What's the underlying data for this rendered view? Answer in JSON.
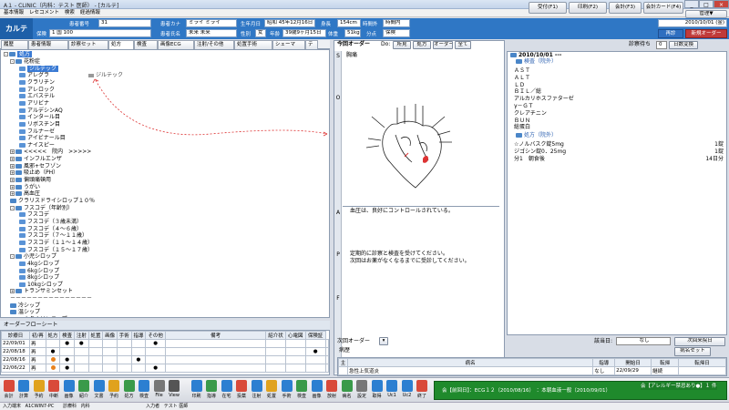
{
  "app": {
    "title": "A１ - CLINIC（内科：テスト 医師） - [カルテ]",
    "menu": [
      "基本情報",
      "レセコメント",
      "検索",
      "経過情報"
    ],
    "top_buttons": [
      "受付(F1)",
      "印刷(F2)",
      "会計(F3)",
      "会計カード(F4)",
      "管理▼"
    ],
    "window_controls": [
      "_",
      "□",
      "×"
    ],
    "status": [
      "入力端末",
      "A1CWIN7-PC",
      "診療科",
      "内科",
      "入力者",
      "テスト 医師"
    ]
  },
  "header": {
    "karte_label": "カルテ",
    "patient_no_label": "患者番号",
    "patient_no": "31",
    "insurance_label": "保険",
    "insurance": "1 国 100",
    "kana_label": "患者カナ",
    "kana": "ミライ ミライ",
    "name_label": "患者氏名",
    "name": "未来 未来",
    "birth_label": "生年月日",
    "birth": "昭和 45年12月16日",
    "sex_label": "性別",
    "sex": "女",
    "age_label": "年齢",
    "age": "39歳9ヶ月15日",
    "height_label": "身長",
    "height": "154cm",
    "weight_label": "体重",
    "weight": "51kg",
    "time_label": "時間外",
    "time_value": "時間内",
    "bunten_label": "分点",
    "bunten_value": "保険",
    "date": "2010/10/01 (金)",
    "btn_resend": "再診",
    "btn_new_order": "新規オーダー"
  },
  "tabs": [
    "履歴",
    "患者情報",
    "診察セット",
    "処方",
    "検査",
    "画像ECG",
    "注射/その他",
    "処置手術",
    "シェーマ",
    "テ"
  ],
  "tree": {
    "root": "処方",
    "drag_hint": "ジルテック",
    "items": [
      {
        "label": "花粉症",
        "level": 1,
        "type": "folder",
        "expand": "-"
      },
      {
        "label": "ジルテック",
        "level": 2,
        "type": "file",
        "selected": true
      },
      {
        "label": "アレグラ",
        "level": 2,
        "type": "file"
      },
      {
        "label": "クラリチン",
        "level": 2,
        "type": "file"
      },
      {
        "label": "アレロック",
        "level": 2,
        "type": "file"
      },
      {
        "label": "エバステル",
        "level": 2,
        "type": "file"
      },
      {
        "label": "アリビナ",
        "level": 2,
        "type": "file"
      },
      {
        "label": "アルデシンAQ",
        "level": 2,
        "type": "file"
      },
      {
        "label": "インタール目",
        "level": 2,
        "type": "file"
      },
      {
        "label": "リボスチン目",
        "level": 2,
        "type": "file"
      },
      {
        "label": "フルナーゼ",
        "level": 2,
        "type": "file"
      },
      {
        "label": "アイビナール目",
        "level": 2,
        "type": "file"
      },
      {
        "label": "ナイスピー",
        "level": 2,
        "type": "file"
      },
      {
        "label": "<<<<<　院内　>>>>>",
        "level": 1,
        "type": "folder",
        "expand": "+"
      },
      {
        "label": "インフルエンザ",
        "level": 1,
        "type": "folder",
        "expand": "+"
      },
      {
        "label": "風邪+セフゾン",
        "level": 1,
        "type": "folder",
        "expand": "+"
      },
      {
        "label": "吸止め（PH）",
        "level": 1,
        "type": "folder",
        "expand": "+"
      },
      {
        "label": "偏頭痛頓用",
        "level": 1,
        "type": "folder",
        "expand": "+"
      },
      {
        "label": "うがい",
        "level": 1,
        "type": "folder",
        "expand": "+"
      },
      {
        "label": "高血圧",
        "level": 1,
        "type": "folder",
        "expand": "+"
      },
      {
        "label": "クラリスドライシロップ１０％",
        "level": 1,
        "type": "folder",
        "expand": ""
      },
      {
        "label": "フスコデ（年齢別）",
        "level": 1,
        "type": "folder",
        "expand": "-"
      },
      {
        "label": "フスコデ",
        "level": 2,
        "type": "file"
      },
      {
        "label": "フスコデ（３歳未満）",
        "level": 2,
        "type": "file"
      },
      {
        "label": "フスコデ（４～６歳）",
        "level": 2,
        "type": "file"
      },
      {
        "label": "フスコデ（７～１１歳）",
        "level": 2,
        "type": "file"
      },
      {
        "label": "フスコデ（１１～１４歳）",
        "level": 2,
        "type": "file"
      },
      {
        "label": "フスコデ（１５～１７歳）",
        "level": 2,
        "type": "file"
      },
      {
        "label": "小児シロップ",
        "level": 1,
        "type": "folder",
        "expand": "-"
      },
      {
        "label": "4kgシロップ",
        "level": 2,
        "type": "file"
      },
      {
        "label": "6kgシロップ",
        "level": 2,
        "type": "file"
      },
      {
        "label": "8kgシロップ",
        "level": 2,
        "type": "file"
      },
      {
        "label": "10kgシロップ",
        "level": 2,
        "type": "file"
      },
      {
        "label": "トランサミンセット",
        "level": 1,
        "type": "folder",
        "expand": "+"
      },
      {
        "label": "－－－－－－－－－－－－－－－",
        "level": 1,
        "type": "text",
        "expand": ""
      },
      {
        "label": "冷シップ",
        "level": 1,
        "type": "folder",
        "expand": ""
      },
      {
        "label": "温シップ",
        "level": 1,
        "type": "folder",
        "expand": ""
      },
      {
        "label": "ホクナリンテープ",
        "level": 1,
        "type": "folder",
        "expand": "+"
      }
    ]
  },
  "order_flow": {
    "title": "オーダーフローシート",
    "headers": [
      "診療日",
      "初/再",
      "処方",
      "検査",
      "注射",
      "処置",
      "画像",
      "手術",
      "指導",
      "その他",
      "備考",
      "紹介状",
      "心電図",
      "保険証"
    ],
    "rows": [
      {
        "date": "22/09/01",
        "kind": "再",
        "marks": [
          "",
          "●",
          "●",
          "",
          "",
          "",
          "",
          "●",
          "",
          "",
          "",
          "",
          ""
        ]
      },
      {
        "date": "22/08/18",
        "kind": "再",
        "marks": [
          "●",
          "",
          "",
          "",
          "",
          "",
          "",
          "",
          "",
          "",
          "",
          "●",
          ""
        ]
      },
      {
        "date": "22/08/16",
        "kind": "再",
        "marks": [
          "orange",
          "●",
          "",
          "",
          "",
          "",
          "●",
          "",
          "",
          "",
          "",
          "",
          ""
        ]
      },
      {
        "date": "22/06/22",
        "kind": "再",
        "marks": [
          "orange",
          "●",
          "",
          "",
          "",
          "",
          "",
          "●",
          "",
          "",
          "",
          "",
          ""
        ]
      }
    ]
  },
  "center": {
    "title": "今回オーダー",
    "do_label": "Do:",
    "do_buttons": [
      "所見",
      "処方",
      "オーダー",
      "全て"
    ],
    "side_labels": [
      "S",
      "O",
      "A",
      "P",
      "F"
    ],
    "s_text": "胸痛",
    "a_text": "血圧は、良好にコントロールされている。",
    "p_text": [
      "定期的に診察と検査を受けてください。",
      "次回はお薬がなくなるまでに受診してください。"
    ],
    "next_order_label": "次回オーダー"
  },
  "right": {
    "days_label": "診察待ち",
    "days_value": "0",
    "days_btn": "日数変換",
    "date": "2010/10/01 ---",
    "lab_folder": "検査（院外）",
    "lab_items": [
      "ＡＳＴ",
      "ＡＬＴ",
      "ＬＤ",
      "ＢＩＬ／総",
      "アルカリホスファターゼ",
      "γ－ＧＴ",
      "クレアチニン",
      "ＢＵＮ",
      "総蛋白"
    ],
    "rx_folder": "処方（院外）",
    "rx_items": [
      {
        "name": "☆ノルバスク錠5mg",
        "qty": "1錠"
      },
      {
        "name": "ジゴシン錠0．25mg",
        "qty": "1錠"
      },
      {
        "name": "分1　朝食後",
        "qty": "14日分"
      }
    ],
    "gaitobi_label": "該当日:",
    "gaitobi_value": "なし",
    "next_visit_btn": "次回来院日",
    "byoreki_title": "病歴",
    "byomei_btn": "病名セット",
    "byoreki_headers": [
      "主",
      "病名",
      "指導",
      "開始日",
      "転帰",
      "転帰日"
    ],
    "byoreki_rows": [
      {
        "main": "",
        "name": "急性上気道炎",
        "guide": "なし",
        "start": "22/09/29",
        "outcome": "継続",
        "end": ""
      },
      {
        "main": "",
        "name": "高血圧",
        "guide": "",
        "start": "",
        "outcome": "",
        "end": ""
      }
    ]
  },
  "toolbar": {
    "buttons": [
      "会計",
      "計算",
      "予約",
      "中断",
      "画像",
      "紹介",
      "文書",
      "予約",
      "処方",
      "検査",
      "File",
      "View",
      "印刷",
      "指導",
      "在宅",
      "投薬",
      "注射",
      "処置",
      "手術",
      "検査",
      "画像",
      "放射",
      "病名",
      "設定",
      "取得",
      "Uc1",
      "Uc2",
      "終了"
    ],
    "message_left": "会【前回日】：ECG１２（2010/08/16）　：本朝血液一般（2010/09/01）",
    "message_right": "会【アレルギー禁忌あり●】１ 件"
  }
}
